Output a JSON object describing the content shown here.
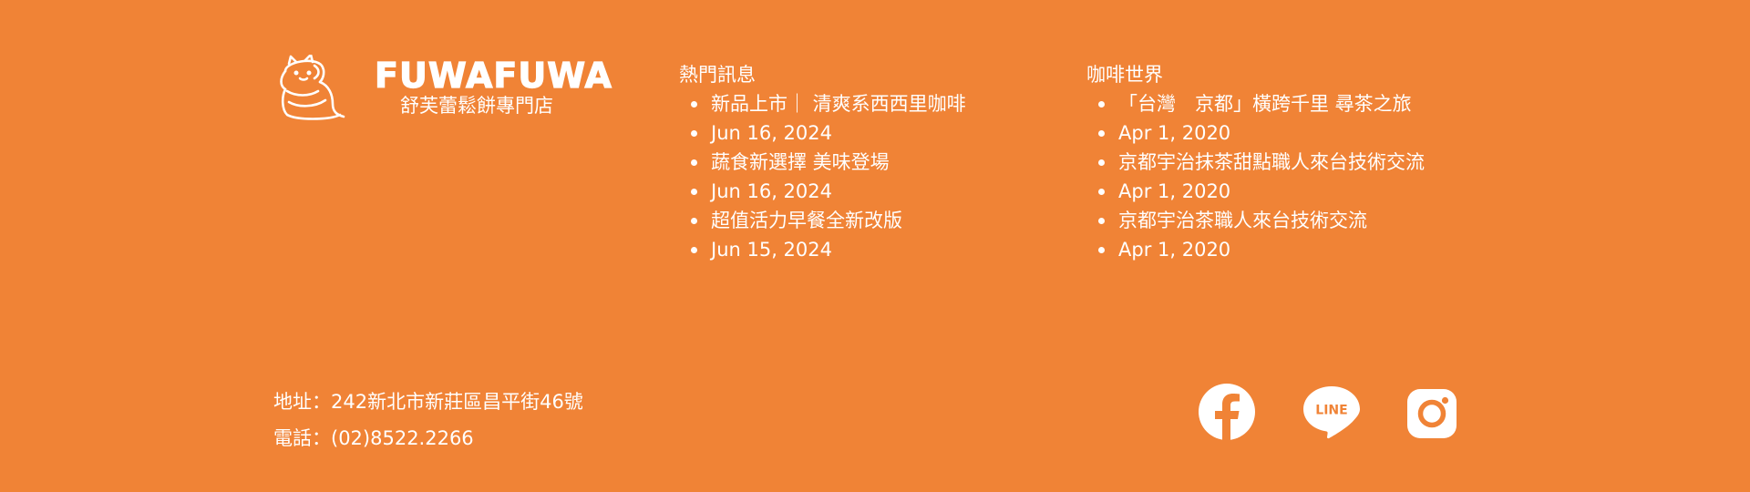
{
  "brand": {
    "wordmark": "FUWAFUWA",
    "subtitle": "舒芙蕾鬆餅專門店"
  },
  "hot_news": {
    "title": "熱門訊息",
    "items": [
      "新品上市｜ 清爽系西西里咖啡",
      "Jun 16, 2024",
      "蔬食新選擇 美味登場",
      "Jun 16, 2024",
      "超值活力早餐全新改版",
      "Jun 15, 2024"
    ]
  },
  "coffee_world": {
    "title": "咖啡世界",
    "items": [
      "「台灣　京都」橫跨千里 尋茶之旅",
      "Apr 1, 2020",
      "京都宇治抹茶甜點職人來台技術交流",
      "Apr 1, 2020",
      "京都宇治茶職人來台技術交流",
      "Apr 1, 2020"
    ]
  },
  "contact": {
    "address": "地址：242新北市新莊區昌平街46號",
    "phone": "電話：(02)8522.2266"
  },
  "social": {
    "facebook_icon": "facebook-icon",
    "line_icon": "line-icon",
    "line_text": "LINE",
    "instagram_icon": "instagram-icon"
  },
  "colors": {
    "background": "#F08336",
    "foreground": "#FFFFFF"
  }
}
